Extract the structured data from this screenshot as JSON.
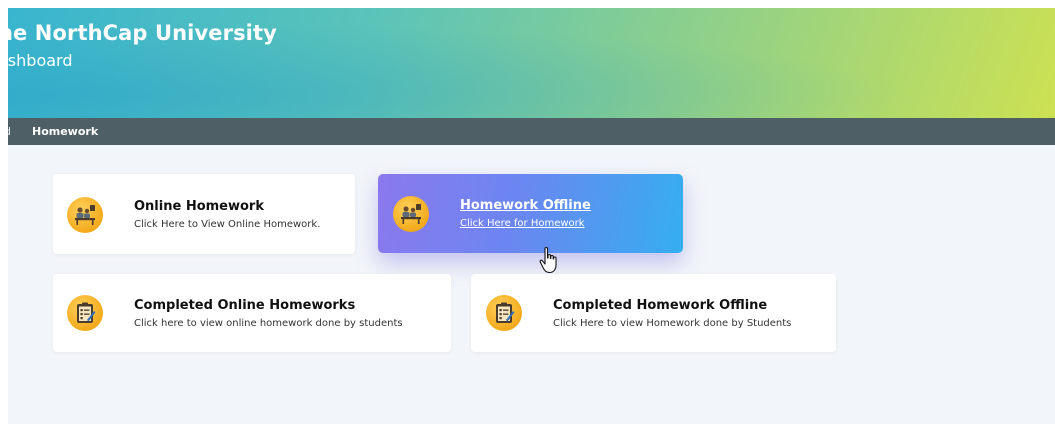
{
  "header": {
    "university": "he NorthCap University",
    "subtitle": "ashboard"
  },
  "navbar": {
    "previous": "d",
    "current": "Homework"
  },
  "cards": {
    "online": {
      "title": "Online Homework",
      "description": "Click Here to View Online Homework."
    },
    "offline": {
      "title": "Homework Offline",
      "description": "Click Here for Homework"
    },
    "completed_online": {
      "title": "Completed Online Homeworks",
      "description": "Click here to view online homework done by students"
    },
    "completed_offline": {
      "title": "Completed Homework Offline",
      "description": "Click Here to view Homework done by Students"
    }
  },
  "colors": {
    "icon_bg": "#f3aa1c",
    "nav_bg": "#4f5f66",
    "offline_gradient_start": "#8b79ee",
    "offline_gradient_end": "#35aef0"
  },
  "icons": {
    "homework": "students-desk-icon",
    "completed": "clipboard-checklist-icon",
    "cursor": "hand-pointer-icon"
  }
}
